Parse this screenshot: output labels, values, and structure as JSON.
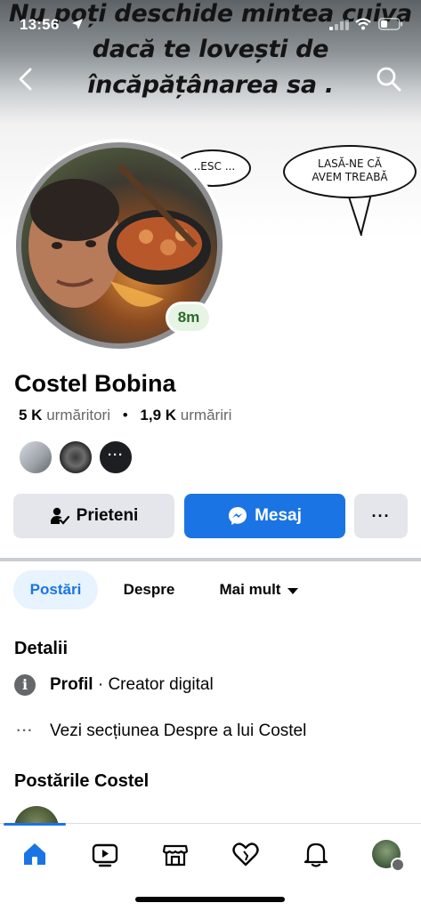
{
  "status_bar": {
    "time": "13:56"
  },
  "cover": {
    "caption_lines": [
      "Nu poți deschide mintea cuiva",
      "dacă te lovești de",
      "încăpățânarea sa ."
    ],
    "bubble_left": "...ESC ...",
    "bubble_right_lines": [
      "LASĂ-NE CĂ",
      "AVEM TREABĂ"
    ]
  },
  "profile": {
    "story_badge": "8m",
    "name": "Costel Bobina",
    "followers_count": "5 K",
    "followers_label": "urmăritori",
    "following_count": "1,9 K",
    "following_label": "urmăriri",
    "mutual_more": "···"
  },
  "actions": {
    "friends_label": "Prieteni",
    "message_label": "Mesaj",
    "more_label": "···"
  },
  "tabs": {
    "posts": "Postări",
    "about": "Despre",
    "more": "Mai mult"
  },
  "details": {
    "title": "Detalii",
    "profile_bold": "Profil",
    "profile_rest": " · Creator digital",
    "about_link": "Vezi secțiunea Despre a lui Costel"
  },
  "posts_section": {
    "title": "Postările Costel"
  },
  "colors": {
    "accent": "#1b74e4",
    "secondary_button": "#e4e6eb",
    "muted_text": "#65676b",
    "story_badge_text": "#2d6a2a"
  },
  "icons": {
    "status": [
      "location-arrow-icon",
      "signal-icon",
      "wifi-icon",
      "battery-icon"
    ],
    "header": [
      "back-chevron-icon",
      "search-icon"
    ],
    "bottom_nav": [
      "home-icon",
      "video-icon",
      "marketplace-icon",
      "dating-heart-icon",
      "bell-icon",
      "profile-avatar"
    ]
  }
}
